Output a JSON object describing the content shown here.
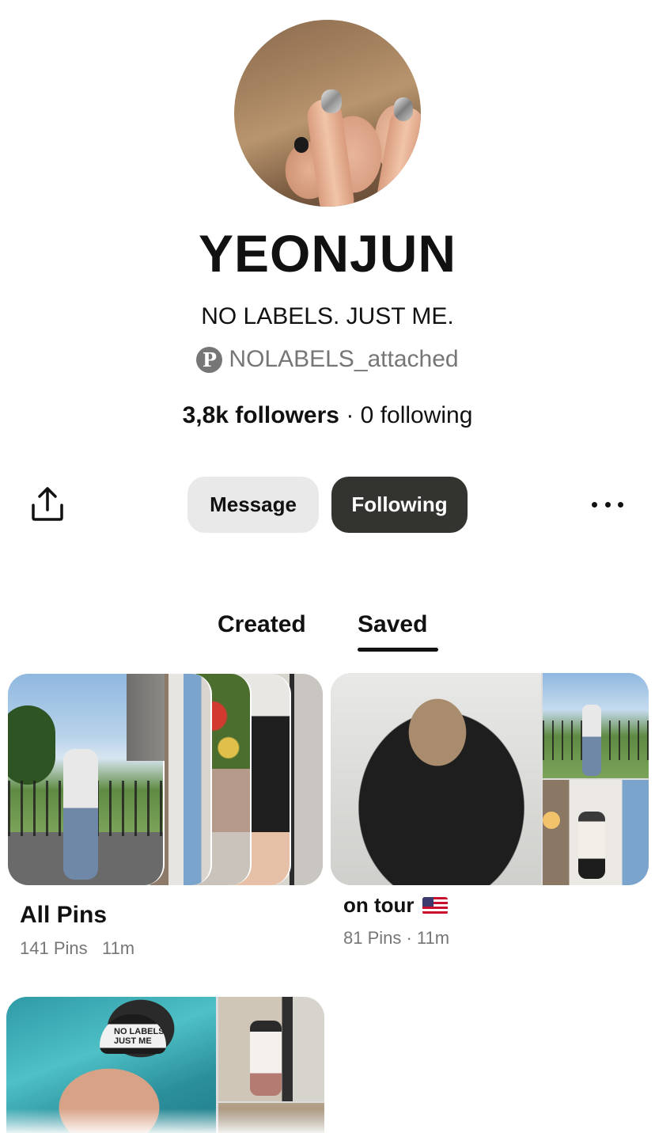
{
  "profile": {
    "name": "YEONJUN",
    "bio": "NO LABELS. JUST ME.",
    "handle": "NOLABELS_attached",
    "followers": "3,8k followers",
    "separator": "·",
    "following": "0 following"
  },
  "actions": {
    "share_icon": "share-upload-icon",
    "message_label": "Message",
    "following_label": "Following",
    "more_icon": "more-horizontal-icon"
  },
  "tabs": [
    {
      "label": "Created",
      "active": false
    },
    {
      "label": "Saved",
      "active": true
    }
  ],
  "boards": [
    {
      "title": "All Pins",
      "pins": "141 Pins",
      "time": "11m"
    },
    {
      "title": "on tour",
      "emoji": "us-flag",
      "meta": "81 Pins · 11m"
    }
  ],
  "images": {
    "cap_text": "NO LABELS JUST ME"
  },
  "colors": {
    "primary_button": "#333330",
    "secondary_button": "#e9e9e9",
    "muted_text": "#767676"
  }
}
